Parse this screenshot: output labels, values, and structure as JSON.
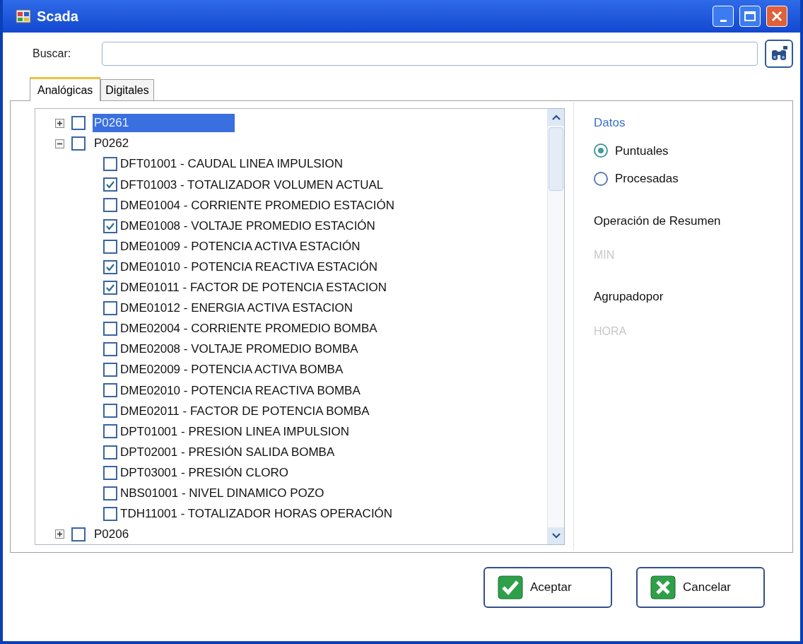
{
  "window": {
    "title": "Scada"
  },
  "search": {
    "label": "Buscar:"
  },
  "tabs": [
    {
      "label": "Analógicas",
      "selected": true
    },
    {
      "label": "Digitales",
      "selected": false
    }
  ],
  "tree": [
    {
      "label": "P0261",
      "expanded": false,
      "checked": false,
      "selected": true
    },
    {
      "label": "P0262",
      "expanded": true,
      "checked": false,
      "selected": false,
      "children": [
        {
          "label": "DFT01001 - CAUDAL LINEA IMPULSION",
          "checked": false
        },
        {
          "label": "DFT01003 - TOTALIZADOR VOLUMEN ACTUAL",
          "checked": true
        },
        {
          "label": "DME01004 - CORRIENTE PROMEDIO ESTACIÓN",
          "checked": false
        },
        {
          "label": "DME01008 - VOLTAJE PROMEDIO ESTACIÓN",
          "checked": true
        },
        {
          "label": "DME01009 - POTENCIA ACTIVA ESTACIÓN",
          "checked": false
        },
        {
          "label": "DME01010 - POTENCIA REACTIVA ESTACIÓN",
          "checked": true
        },
        {
          "label": "DME01011 - FACTOR DE POTENCIA ESTACION",
          "checked": true
        },
        {
          "label": "DME01012 - ENERGIA ACTIVA ESTACION",
          "checked": false
        },
        {
          "label": "DME02004 - CORRIENTE PROMEDIO BOMBA",
          "checked": false
        },
        {
          "label": "DME02008 - VOLTAJE PROMEDIO BOMBA",
          "checked": false
        },
        {
          "label": "DME02009 - POTENCIA ACTIVA BOMBA",
          "checked": false
        },
        {
          "label": "DME02010 - POTENCIA REACTIVA BOMBA",
          "checked": false
        },
        {
          "label": "DME02011 - FACTOR DE POTENCIA BOMBA",
          "checked": false
        },
        {
          "label": "DPT01001 - PRESION LINEA IMPULSION",
          "checked": false
        },
        {
          "label": "DPT02001 - PRESIÓN SALIDA BOMBA",
          "checked": false
        },
        {
          "label": "DPT03001 - PRESIÓN CLORO",
          "checked": false
        },
        {
          "label": "NBS01001 - NIVEL DINAMICO POZO",
          "checked": false
        },
        {
          "label": "TDH11001 - TOTALIZADOR HORAS OPERACIÓN",
          "checked": false
        }
      ]
    },
    {
      "label": "P0206",
      "expanded": false,
      "checked": false,
      "selected": false
    }
  ],
  "datos": {
    "title": "Datos",
    "options": [
      {
        "label": "Puntuales",
        "selected": true
      },
      {
        "label": "Procesadas",
        "selected": false
      }
    ]
  },
  "resumen": {
    "label": "Operación de Resumen",
    "value": "MIN",
    "disabled": true
  },
  "agrupado": {
    "label": "Agrupadopor",
    "value": "HORA",
    "disabled": true
  },
  "buttons": [
    {
      "label": "Aceptar",
      "kind": "ok"
    },
    {
      "label": "Cancelar",
      "kind": "cancel"
    }
  ]
}
